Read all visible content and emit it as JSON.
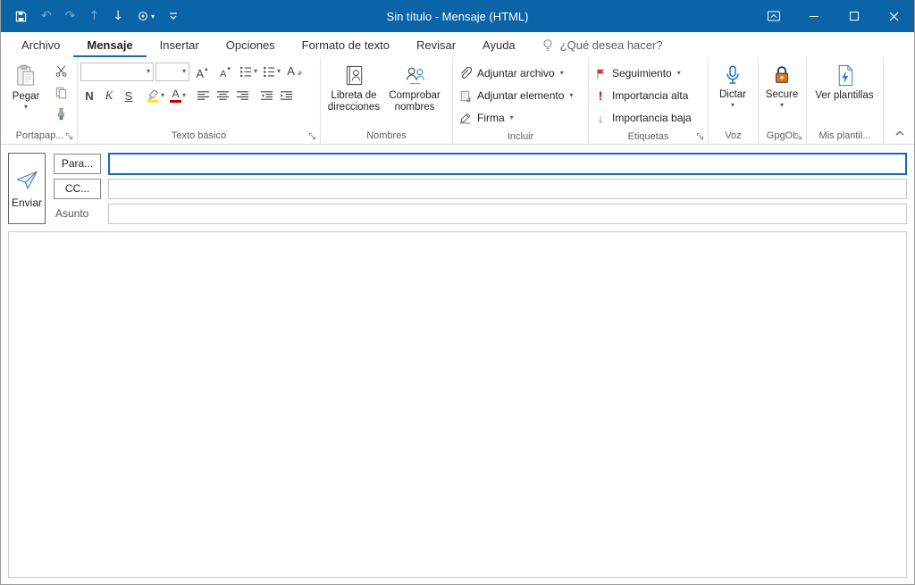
{
  "colors": {
    "titlebar": "#0b63a8",
    "accent": "#0f6cbd",
    "flag": "#d13438",
    "importance_high": "#c50f1f",
    "importance_low": "#2b7cd3",
    "highlight": "#ffe100",
    "font_color": "#c00000",
    "lock_body": "#e8710a",
    "lock_shackle": "#1f3864"
  },
  "titlebar": {
    "title": "Sin título -  Mensaje (HTML)"
  },
  "tabs": {
    "archivo": "Archivo",
    "mensaje": "Mensaje",
    "insertar": "Insertar",
    "opciones": "Opciones",
    "formato": "Formato de texto",
    "revisar": "Revisar",
    "ayuda": "Ayuda",
    "tellme": "¿Qué desea hacer?"
  },
  "icons": {
    "caret": "▾",
    "caret_up": "▴",
    "undo": "↶",
    "redo": "↷",
    "arrow_up": "↑",
    "arrow_down": "↓",
    "bold_letter": "N",
    "italic_letter": "K",
    "underline_letter": "S",
    "letter_a": "A",
    "importance_high_glyph": "!",
    "importance_low_glyph": "↓"
  },
  "ribbon": {
    "clipboard": {
      "group": "Portapap...",
      "paste": "Pegar"
    },
    "basic_text": {
      "group": "Texto básico",
      "font_value": "",
      "size_value": ""
    },
    "names": {
      "group": "Nombres",
      "address_book": "Libreta de direcciones",
      "check_names": "Comprobar nombres"
    },
    "include": {
      "group": "Incluir",
      "attach_file": "Adjuntar archivo",
      "attach_item": "Adjuntar elemento",
      "signature": "Firma"
    },
    "tags": {
      "group": "Etiquetas",
      "follow_up": "Seguimiento",
      "high": "Importancia alta",
      "low": "Importancia baja"
    },
    "voice": {
      "group": "Voz",
      "dictate": "Dictar"
    },
    "gpgol": {
      "group": "GpgOL",
      "secure": "Secure"
    },
    "templates": {
      "group": "Mis plantil...",
      "view": "Ver plantillas"
    }
  },
  "compose": {
    "send": "Enviar",
    "to_label": "Para...",
    "cc_label": "CC...",
    "subject_label": "Asunto",
    "to_value": "",
    "cc_value": "",
    "subject_value": "",
    "body_value": ""
  }
}
